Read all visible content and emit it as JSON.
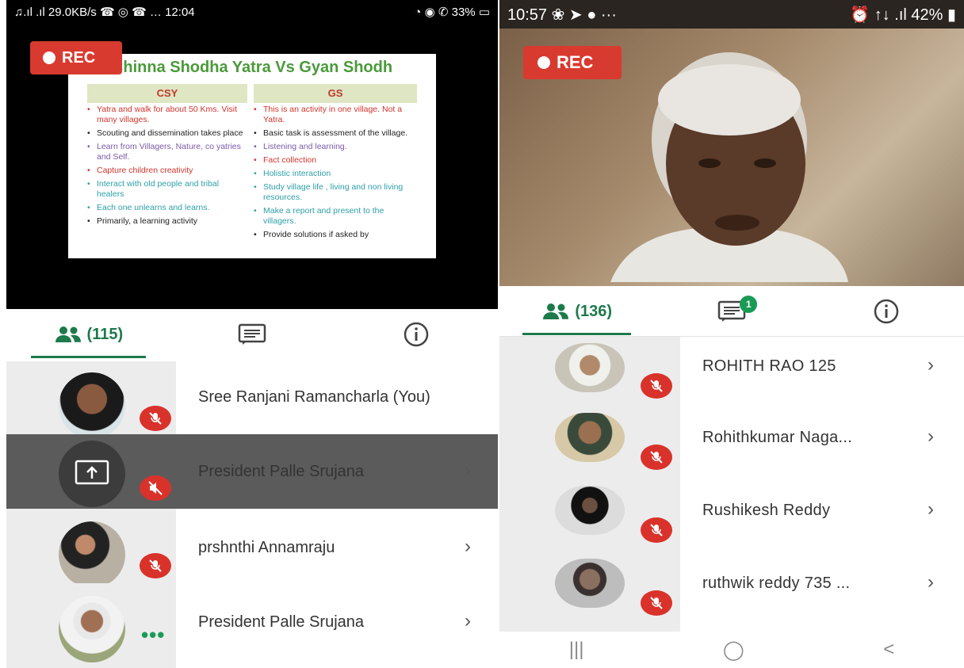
{
  "left": {
    "statusbar": {
      "left": "♫.ıl .ıl 29.0KB/s ☎ ◎ ☎ …  12:04",
      "right": "◔ ◉ ✆ 33% ▭"
    },
    "rec_label": "REC",
    "slide": {
      "title": "Chinna Shodha Yatra Vs Gyan Shodh",
      "col1_head": "CSY",
      "col2_head": "GS",
      "col1": [
        "Yatra and walk for about 50 Kms. Visit many villages.",
        "Scouting and dissemination takes place",
        "Learn from Villagers, Nature, co yatries and Self.",
        "Capture children creativity",
        "Interact with old people and tribal healers",
        "Each one unlearns and learns.",
        "Primarily, a learning activity"
      ],
      "col2": [
        "This is an activity in one village. Not a Yatra.",
        "Basic task is assessment of the village.",
        "Listening and learning.",
        "Fact collection",
        "Holistic interaction",
        "Study village life , living and non living resources.",
        "Make a report and present to the villagers.",
        "Provide solutions if asked by"
      ]
    },
    "tabs": {
      "participants_count": "(115)"
    },
    "participants": [
      {
        "name": "Sree Ranjani Ramancharla (You)"
      },
      {
        "name": "President Palle Srujana"
      },
      {
        "name": "prshnthi Annamraju"
      },
      {
        "name": "President Palle Srujana"
      }
    ]
  },
  "right": {
    "statusbar": {
      "left": "10:57 ❀ ➤ ●  ···",
      "right": "⏰ ↑↓ .ıl 42% ▮"
    },
    "rec_label": "REC",
    "tabs": {
      "participants_count": "(136)",
      "chat_badge": "1"
    },
    "participants": [
      {
        "name": "ROHITH RAO 125"
      },
      {
        "name": "Rohithkumar Naga..."
      },
      {
        "name": "Rushikesh Reddy"
      },
      {
        "name": "ruthwik reddy 735 ..."
      }
    ],
    "navbar": {
      "recent": "|||",
      "home": "◯",
      "back": "<"
    }
  },
  "colors": {
    "accent": "#1c7a4b",
    "rec": "#d93a2f",
    "mute": "#d9322b"
  }
}
